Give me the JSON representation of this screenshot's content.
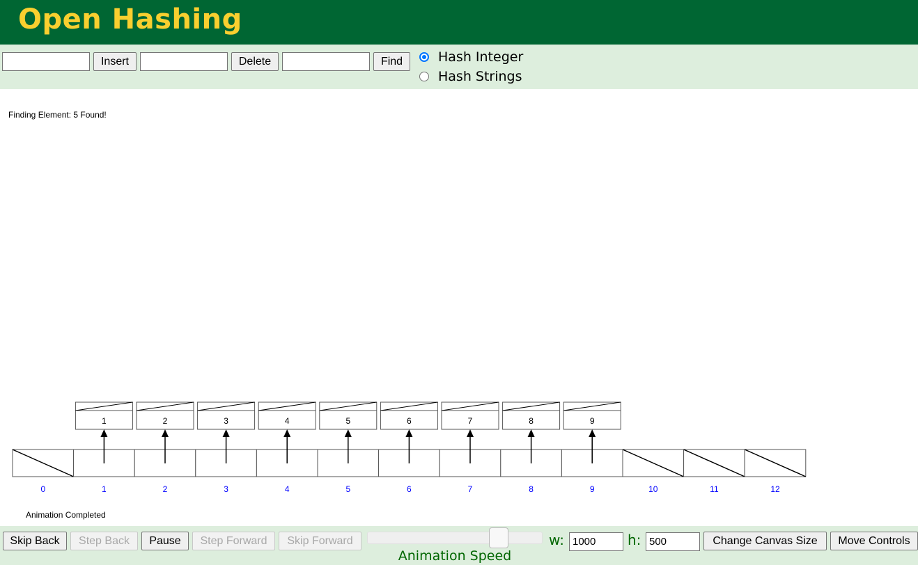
{
  "header": {
    "title": "Open Hashing"
  },
  "controls": {
    "insert_value": "",
    "insert_label": "Insert",
    "delete_value": "",
    "delete_label": "Delete",
    "find_value": "",
    "find_label": "Find",
    "hash_integer_label": "Hash Integer",
    "hash_strings_label": "Hash Strings",
    "selected_hash_mode": "Hash Integer"
  },
  "canvas": {
    "status_message": "Finding Element: 5  Found!",
    "animation_status": "Animation Completed",
    "table_indices": [
      "0",
      "1",
      "2",
      "3",
      "4",
      "5",
      "6",
      "7",
      "8",
      "9",
      "10",
      "11",
      "12"
    ],
    "bucket_elements": [
      {
        "index": 0,
        "values": []
      },
      {
        "index": 1,
        "values": [
          "1"
        ]
      },
      {
        "index": 2,
        "values": [
          "2"
        ]
      },
      {
        "index": 3,
        "values": [
          "3"
        ]
      },
      {
        "index": 4,
        "values": [
          "4"
        ]
      },
      {
        "index": 5,
        "values": [
          "5"
        ]
      },
      {
        "index": 6,
        "values": [
          "6"
        ]
      },
      {
        "index": 7,
        "values": [
          "7"
        ]
      },
      {
        "index": 8,
        "values": [
          "8"
        ]
      },
      {
        "index": 9,
        "values": [
          "9"
        ]
      },
      {
        "index": 10,
        "values": []
      },
      {
        "index": 11,
        "values": []
      },
      {
        "index": 12,
        "values": []
      }
    ],
    "index_color": "#0000ff"
  },
  "animation_controls": {
    "skip_back": "Skip Back",
    "step_back": "Step Back",
    "pause": "Pause",
    "step_forward": "Step Forward",
    "skip_forward": "Skip Forward",
    "speed_label": "Animation Speed",
    "width_label": "w:",
    "width_value": "1000",
    "height_label": "h:",
    "height_value": "500",
    "change_canvas_size": "Change Canvas Size",
    "move_controls": "Move Controls"
  },
  "colors": {
    "header_bg": "#006633",
    "title": "#f9cf2f",
    "panel_bg": "#ddeedd",
    "speed_label": "#006600"
  }
}
